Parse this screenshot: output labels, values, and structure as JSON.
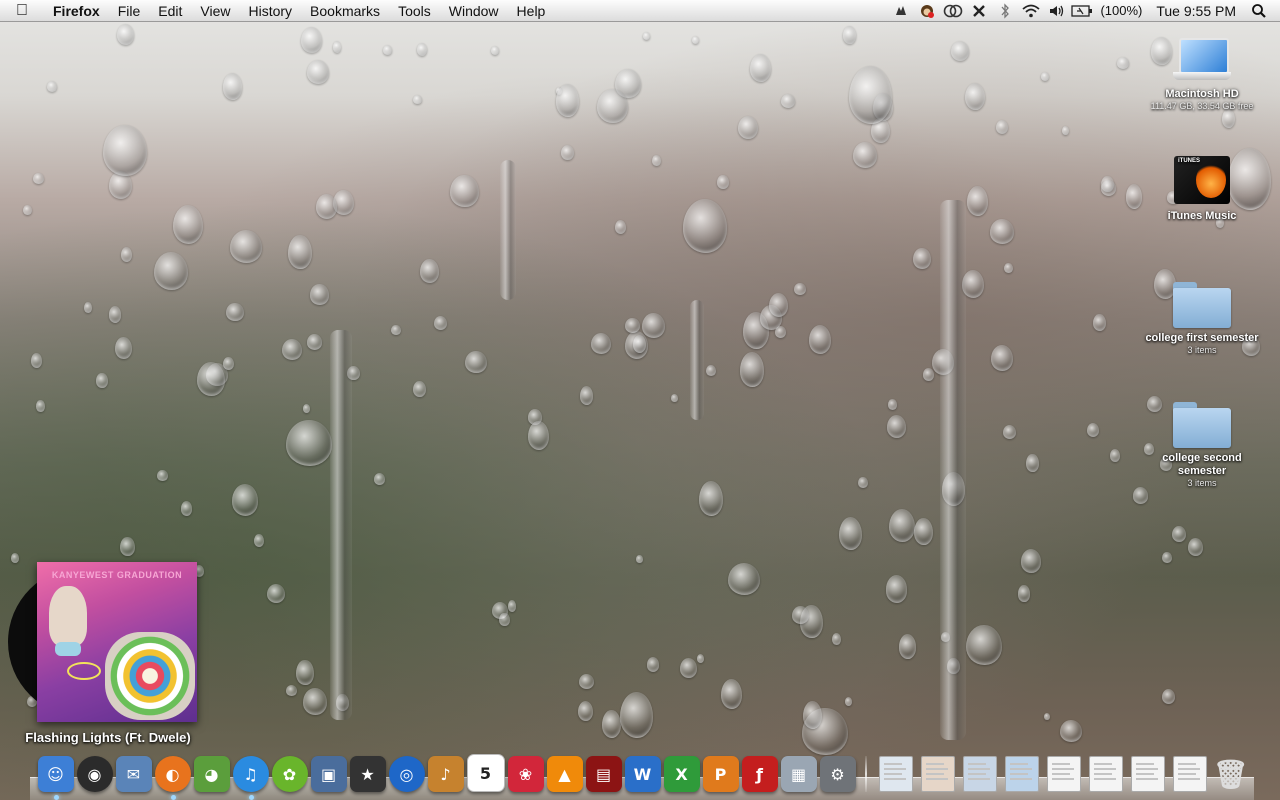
{
  "menubar": {
    "app_name": "Firefox",
    "menus": [
      "File",
      "Edit",
      "View",
      "History",
      "Bookmarks",
      "Tools",
      "Window",
      "Help"
    ],
    "battery_text": "(100%)",
    "clock": "Tue 9:55 PM",
    "status_icons": [
      "growl-icon",
      "monkey-icon",
      "sync-icon",
      "tools-icon",
      "bluetooth-icon",
      "wifi-icon",
      "volume-icon",
      "battery-icon"
    ]
  },
  "desktop": {
    "icons": [
      {
        "label": "Macintosh HD",
        "sub": "111.47 GB, 33.54 GB free",
        "icon": "laptop-drive-icon"
      },
      {
        "label": "iTunes Music",
        "sub": "",
        "icon": "itunes-folder-icon"
      },
      {
        "label": "college first semester",
        "sub": "3 items",
        "icon": "folder-icon"
      },
      {
        "label": "college second semester",
        "sub": "3 items",
        "icon": "folder-icon"
      }
    ]
  },
  "now_playing": {
    "album_title": "KANYEWEST GRADUATION",
    "song": "Flashing Lights (Ft. Dwele)"
  },
  "dock": {
    "apps": [
      {
        "name": "finder",
        "glyph": "☺",
        "color": "#3d7fd6",
        "running": true
      },
      {
        "name": "dashboard",
        "glyph": "◉",
        "color": "#2b2b2b",
        "running": false
      },
      {
        "name": "mail",
        "glyph": "✉",
        "color": "#5a84b8",
        "running": false
      },
      {
        "name": "firefox",
        "glyph": "◐",
        "color": "#e8731d",
        "running": true
      },
      {
        "name": "adium",
        "glyph": "◕",
        "color": "#5b9e3c",
        "running": false
      },
      {
        "name": "itunes",
        "glyph": "♫",
        "color": "#2a8be0",
        "running": true
      },
      {
        "name": "coconut",
        "glyph": "✿",
        "color": "#69b52b",
        "running": false
      },
      {
        "name": "iphoto",
        "glyph": "▣",
        "color": "#4a6d9c",
        "running": false
      },
      {
        "name": "imovie",
        "glyph": "★",
        "color": "#333333",
        "running": false
      },
      {
        "name": "dvd-player",
        "glyph": "◎",
        "color": "#1e67c8",
        "running": false
      },
      {
        "name": "garageband",
        "glyph": "♪",
        "color": "#c6822e",
        "running": false
      },
      {
        "name": "ical",
        "glyph": "5",
        "color": "#ffffff",
        "running": false
      },
      {
        "name": "flower-photo",
        "glyph": "❀",
        "color": "#d2263a",
        "running": false
      },
      {
        "name": "vlc",
        "glyph": "▲",
        "color": "#f08a0a",
        "running": false
      },
      {
        "name": "photo-booth",
        "glyph": "▤",
        "color": "#8c1414",
        "running": false
      },
      {
        "name": "word",
        "glyph": "W",
        "color": "#2a6fc9",
        "running": false
      },
      {
        "name": "excel",
        "glyph": "X",
        "color": "#2f9b3a",
        "running": false
      },
      {
        "name": "powerpoint",
        "glyph": "P",
        "color": "#e07a1c",
        "running": false
      },
      {
        "name": "flash",
        "glyph": "ƒ",
        "color": "#c41e1e",
        "running": false
      },
      {
        "name": "preview",
        "glyph": "▦",
        "color": "#9aa6b3",
        "running": false
      },
      {
        "name": "system-preferences",
        "glyph": "⚙",
        "color": "#6f7378",
        "running": false
      }
    ],
    "stacks": [
      {
        "name": "documents-stack",
        "color": "#dfe7ef"
      },
      {
        "name": "pictures-stack",
        "color": "#e6d6c8"
      },
      {
        "name": "movies-stack",
        "color": "#c8d6e6"
      },
      {
        "name": "downloads-stack",
        "color": "#bcd3ea"
      },
      {
        "name": "doc-1",
        "color": "#f4f4f4"
      },
      {
        "name": "doc-2",
        "color": "#f4f4f4"
      },
      {
        "name": "doc-3",
        "color": "#f4f4f4"
      },
      {
        "name": "doc-4",
        "color": "#f4f4f4"
      }
    ],
    "trash": {
      "name": "trash",
      "glyph": "🗑"
    }
  }
}
